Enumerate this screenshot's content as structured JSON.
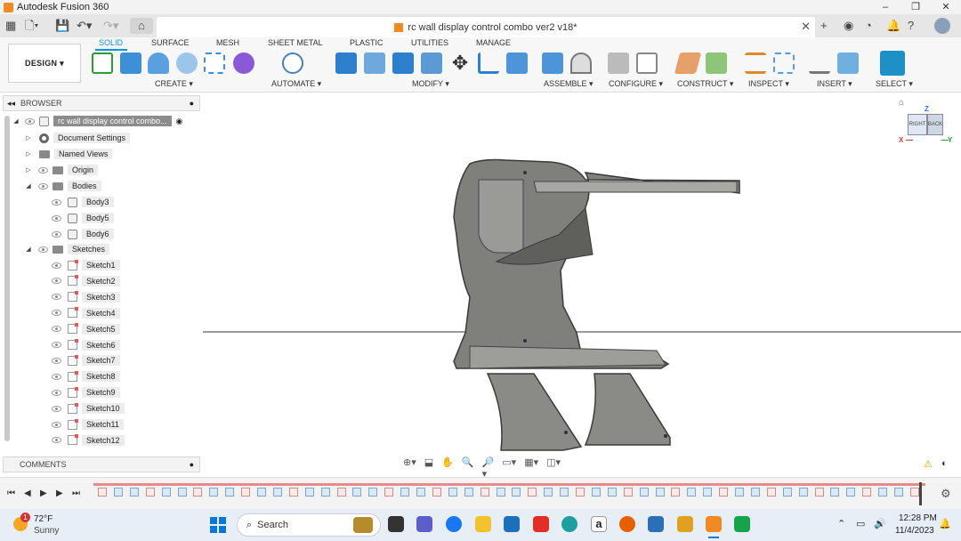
{
  "window": {
    "title": "Autodesk Fusion 360",
    "buttons": [
      "–",
      "❐",
      "✕"
    ]
  },
  "document": {
    "title": "rc wall display control combo ver2 v18*"
  },
  "ribbon": {
    "workspace": "DESIGN ▾",
    "tabs": [
      "SOLID",
      "SURFACE",
      "MESH",
      "SHEET METAL",
      "PLASTIC",
      "UTILITIES",
      "MANAGE"
    ],
    "groups": [
      "CREATE ▾",
      "AUTOMATE ▾",
      "MODIFY ▾",
      "ASSEMBLE ▾",
      "CONFIGURE ▾",
      "CONSTRUCT ▾",
      "INSPECT ▾",
      "INSERT ▾",
      "SELECT ▾"
    ]
  },
  "browser": {
    "header": "BROWSER",
    "root": "rc wall display control combo...",
    "items": {
      "document_settings": "Document Settings",
      "named_views": "Named Views",
      "origin": "Origin",
      "bodies": "Bodies",
      "body3": "Body3",
      "body5": "Body5",
      "body6": "Body6",
      "sketches": "Sketches"
    },
    "sketches": [
      "Sketch1",
      "Sketch2",
      "Sketch3",
      "Sketch4",
      "Sketch5",
      "Sketch6",
      "Sketch7",
      "Sketch8",
      "Sketch9",
      "Sketch10",
      "Sketch11",
      "Sketch12"
    ]
  },
  "comments": {
    "label": "COMMENTS"
  },
  "viewcube": {
    "top": "Z",
    "x": "X",
    "y": "Y",
    "right": "RIGHT",
    "back": "BACK"
  },
  "taskbar": {
    "weather_temp": "72°F",
    "weather_desc": "Sunny",
    "weather_badge": "1",
    "search": "Search",
    "time": "12:28 PM",
    "date": "11/4/2023"
  },
  "colors": {
    "accent": "#0696d7",
    "brand": "#f08a24",
    "model": "#8c8c88"
  }
}
